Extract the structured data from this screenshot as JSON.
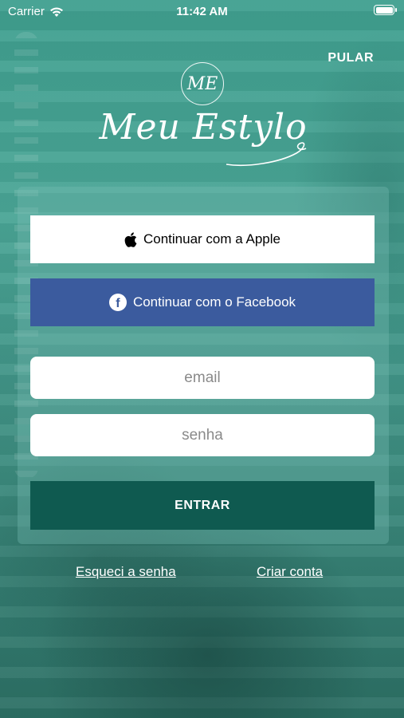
{
  "status_bar": {
    "carrier": "Carrier",
    "time": "11:42 AM"
  },
  "header": {
    "skip_label": "PULAR"
  },
  "logo": {
    "monogram": "ME",
    "wordmark": "Meu Estylo"
  },
  "login": {
    "apple_label": "Continuar com a Apple",
    "facebook_label": "Continuar com o Facebook",
    "facebook_glyph": "f",
    "email_placeholder": "email",
    "password_placeholder": "senha",
    "enter_label": "ENTRAR"
  },
  "links": {
    "forgot_password": "Esqueci a senha",
    "create_account": "Criar conta"
  },
  "colors": {
    "background_teal": "#3f9a8a",
    "facebook_blue": "#3b5b9e",
    "enter_button": "#0f5a50"
  }
}
